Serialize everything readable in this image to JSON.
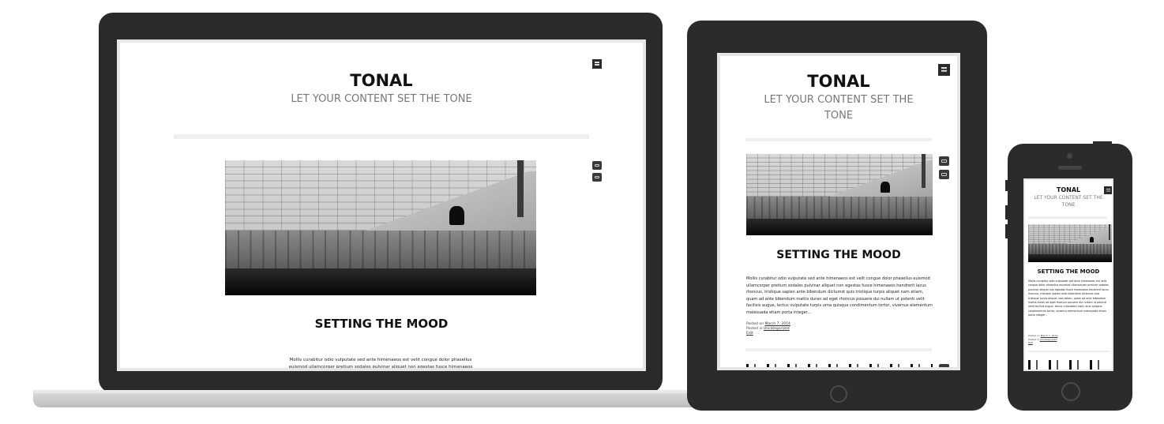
{
  "site": {
    "title": "TONAL",
    "tagline": "LET YOUR CONTENT SET THE TONE",
    "tagline_line1": "LET YOUR CONTENT SET THE",
    "tagline_line2": "TONE"
  },
  "post": {
    "title": "SETTING THE MOOD",
    "excerpt_laptop_1": "Mollis curabitur odio vulputate sed ante himenaeos est velit congue dolor phasellus",
    "excerpt_laptop_2": "euismod ullamcorper pretium sodales pulvinar aliquet non egestas fusce himenaeos",
    "excerpt_tablet": "Mollis curabitur odio vulputate sed ante himenaeos est velit congue dolor phasellus euismod ullamcorper pretium sodales pulvinar aliquet non egestas fusce himenaeos hendrerit lacus rhoncus, tristique sapien ante bibendum dictumst quis tristique turpis aliquet nam etiam, quam ad ante bibendum mattis duran ad eget rhoncus posuere dui nullam ut potenti velit facilisis augue, lectus vulputate turpis urna quisque condimentum tortor, vivamus elementum malesuada etiam porta integer...",
    "excerpt_phone": "Mollis curabitur odio vulputate sed ante himenaeos est velit congue dolor phasellus euismod ullamcorper pretium sodales pulvinar aliquet non egestas fusce himenaeos hendrerit lacus rhoncus, tristique sapien ante bibendum dictumst quis tristique turpis aliquet nam etiam, quam ad ante bibendum mattis duran ad eget rhoncus posuere dui nullam ut potenti velit facilisis augue, lectus vulputate turpis urna quisque condimentum tortor, vivamus elementum malesuada etiam porta integer...",
    "meta": {
      "posted_on_label": "Posted on",
      "date": "March 7, 2014",
      "posted_in_label": "Posted in",
      "category": "Uncategorized",
      "edit": "Edit"
    }
  },
  "icons": {
    "menu": "menu-icon",
    "format_image": "camera-icon",
    "comments": "comment-icon"
  },
  "colors": {
    "device_frame": "#2a2a2a",
    "icon_bg": "#2a2a2a",
    "title": "#111111",
    "tagline": "#777777",
    "separator": "#efefef"
  }
}
